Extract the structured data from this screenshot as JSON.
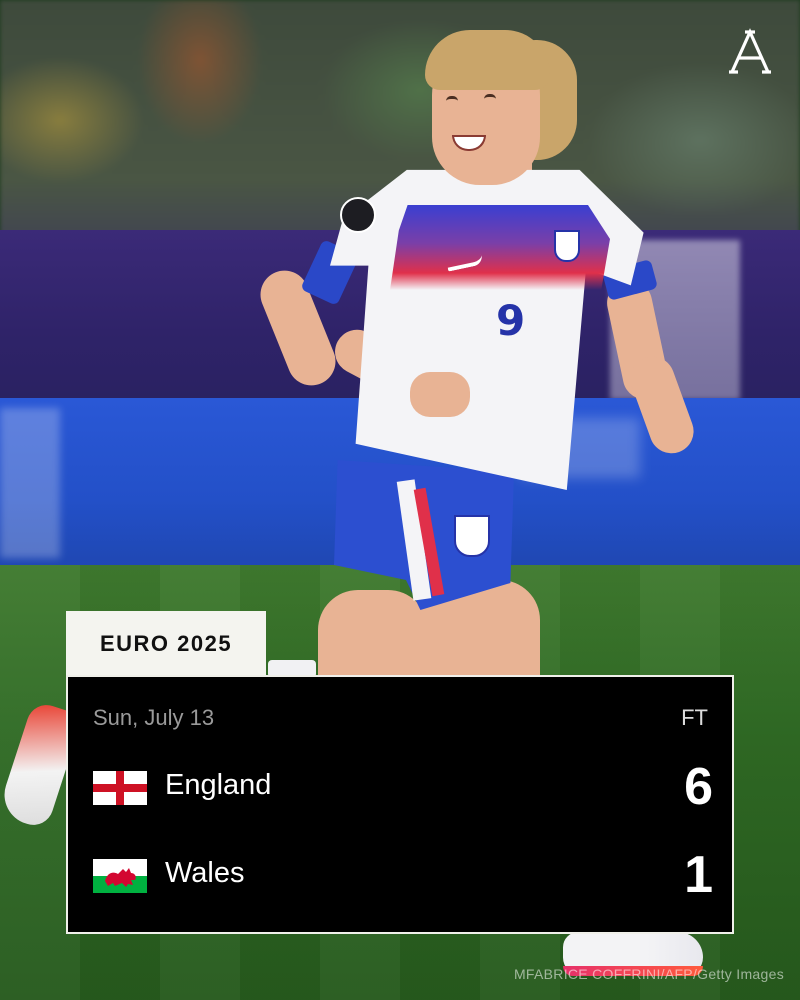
{
  "brand": {
    "logo_letter": "A",
    "logo_icon": "the-athletic-logo-icon"
  },
  "competition": {
    "label": "EURO 2025"
  },
  "match": {
    "date": "Sun, July 13",
    "status": "FT",
    "home": {
      "name": "England",
      "score": "6",
      "flag_icon": "england-flag-icon"
    },
    "away": {
      "name": "Wales",
      "score": "1",
      "flag_icon": "wales-flag-icon"
    }
  },
  "player": {
    "shirt_number": "9"
  },
  "photo_credit": "MFABRICE COFFRINI/AFP/Getty Images",
  "colors": {
    "card_background": "#000000",
    "tab_background": "#f4f4ef",
    "england_red": "#ce1124",
    "wales_green": "#00b140",
    "wales_red": "#d30731"
  }
}
